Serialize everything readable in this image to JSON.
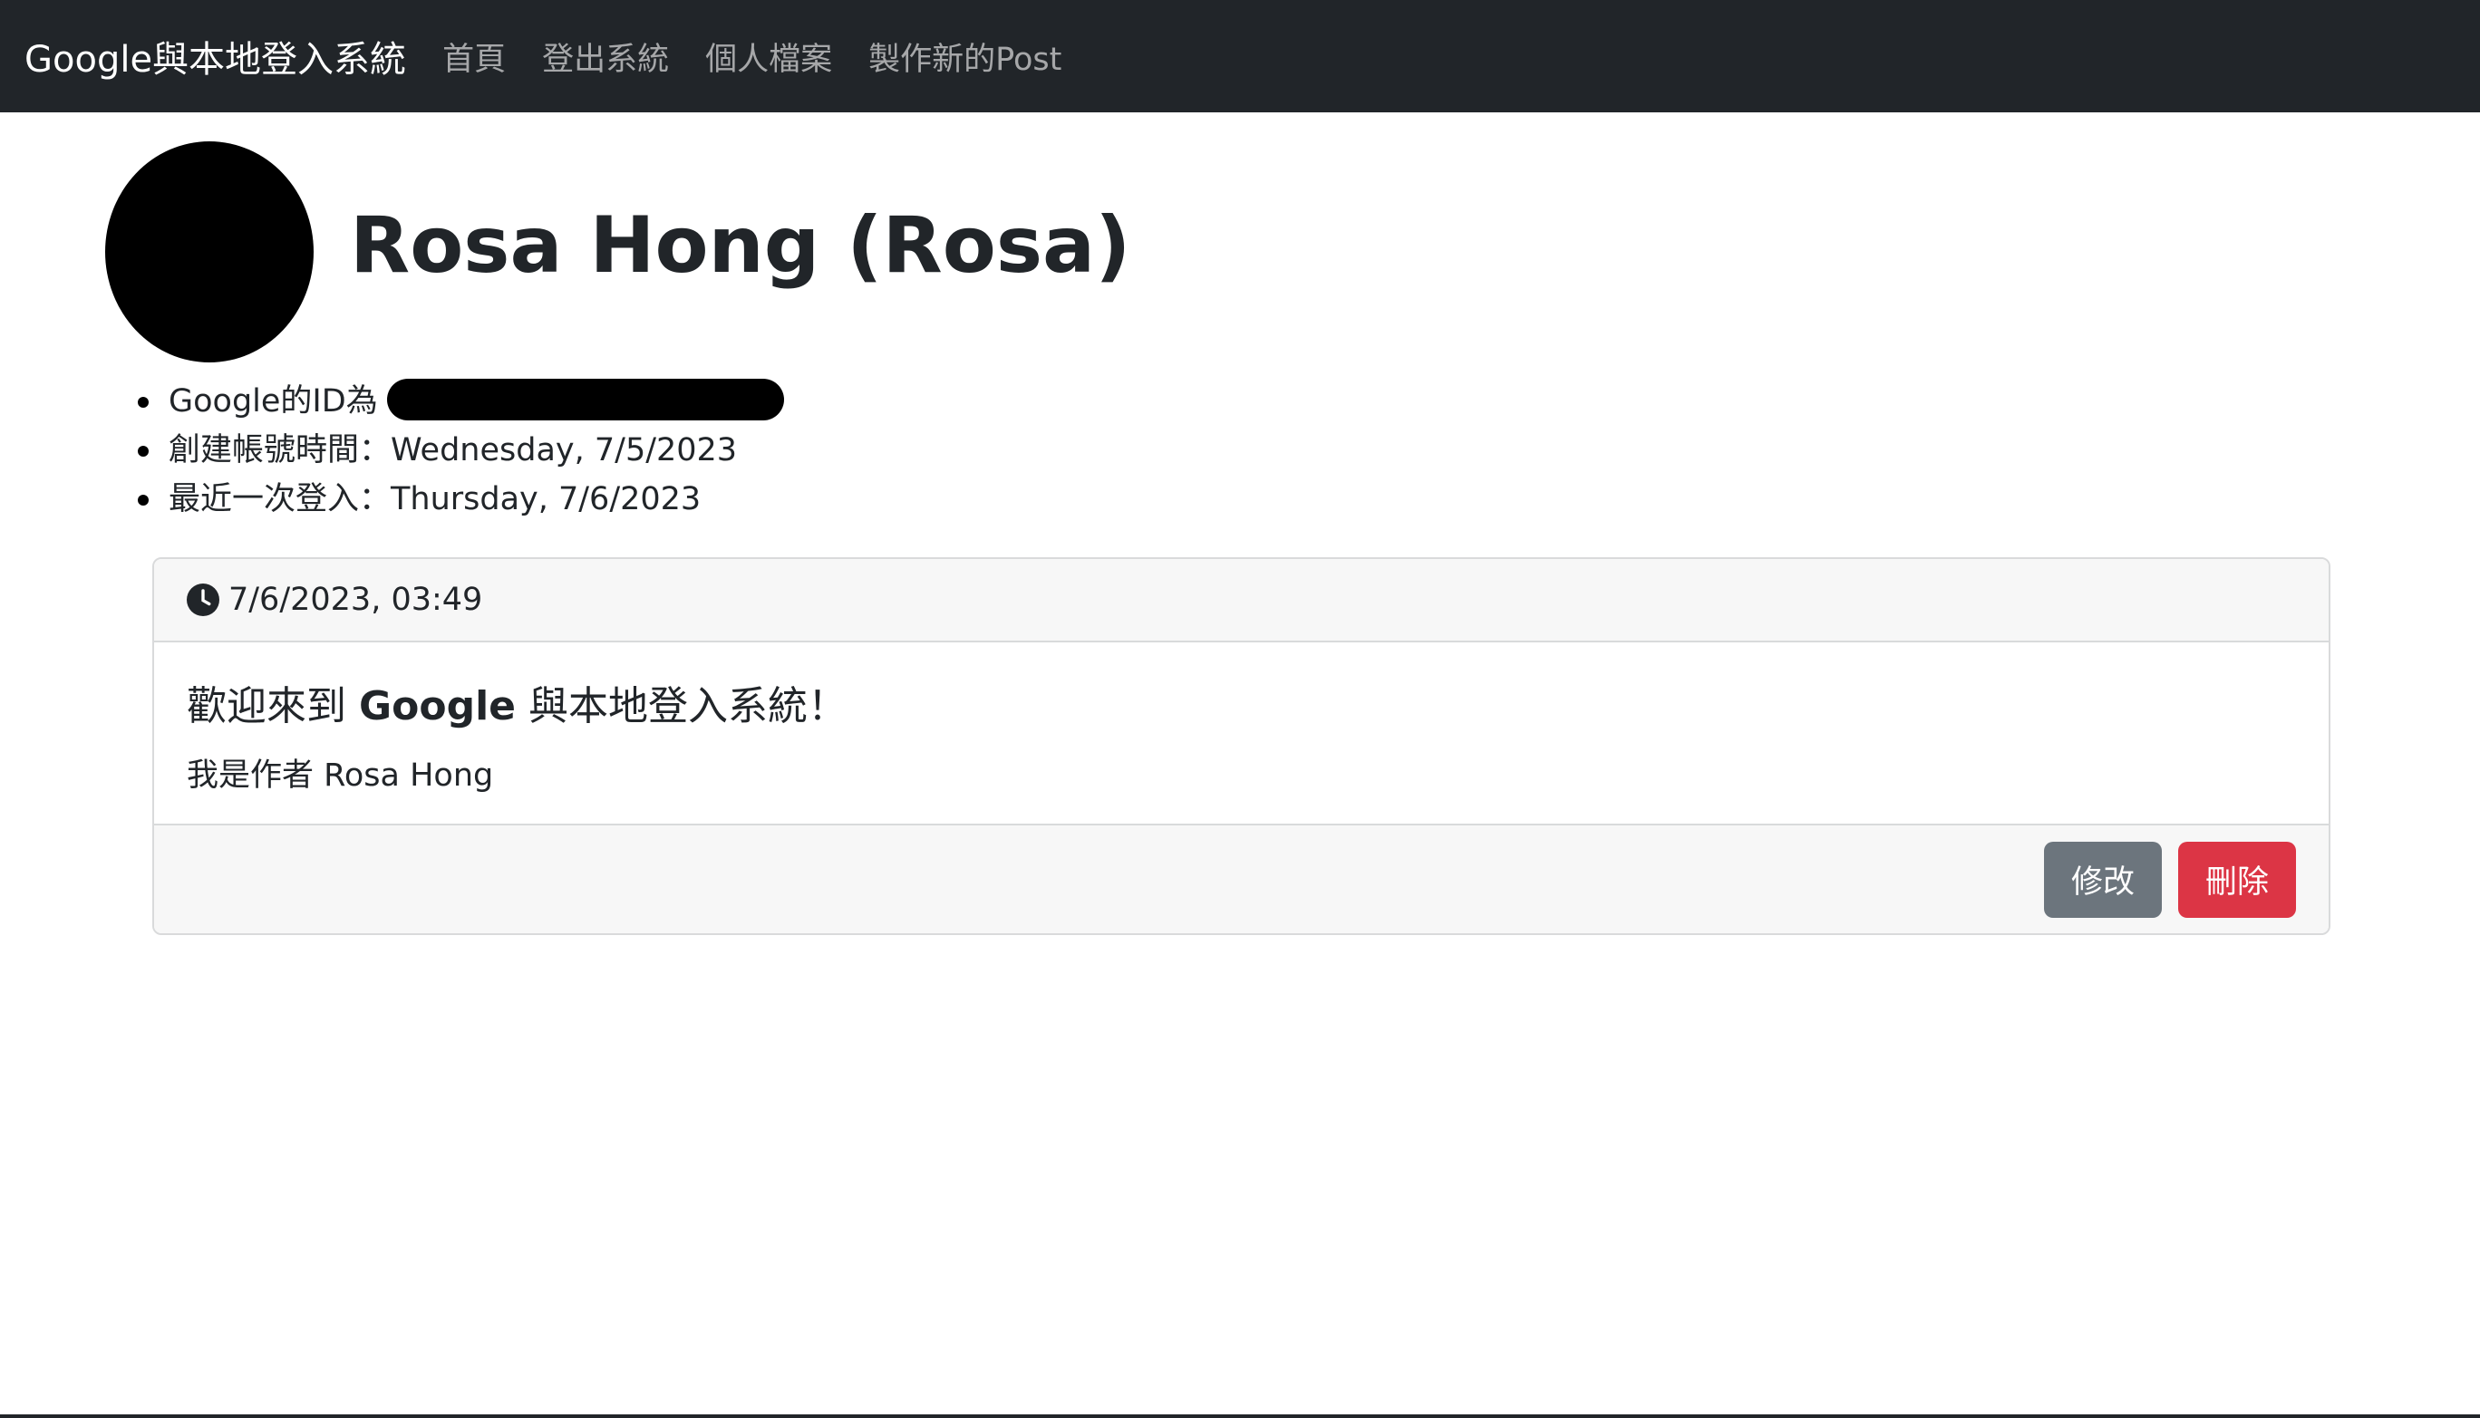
{
  "navbar": {
    "brand": "Google與本地登入系統",
    "links": [
      "首頁",
      "登出系統",
      "個人檔案",
      "製作新的Post"
    ]
  },
  "profile": {
    "name": "Rosa Hong (Rosa)",
    "info": {
      "google_id_label": "Google的ID為",
      "created_label": "創建帳號時間：Wednesday, 7/5/2023",
      "last_login_label": "最近一次登入：Thursday, 7/6/2023"
    }
  },
  "post": {
    "timestamp": "7/6/2023, 03:49",
    "title_prefix": "歡迎來到 ",
    "title_bold": "Google",
    "title_suffix": " 與本地登入系統！",
    "body": "我是作者 Rosa Hong",
    "edit_label": "修改",
    "delete_label": "刪除"
  },
  "colors": {
    "navbar_bg": "#212529",
    "edit_button": "#6c757d",
    "delete_button": "#dc3545"
  }
}
